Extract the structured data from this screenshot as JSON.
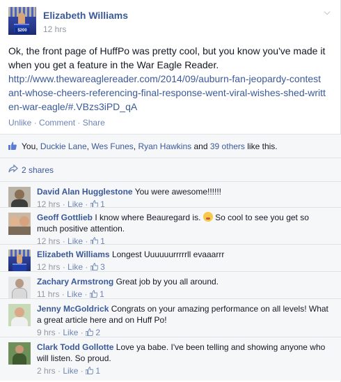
{
  "post": {
    "author": "Elizabeth Williams",
    "time": "12 hrs",
    "avatar_amount": "$200",
    "text": "Ok, the front page of HuffPo was pretty cool, but you know you've made it when you get a feature in the War Eagle Reader.",
    "url": "http://www.thewareaglereader.com/2014/09/auburn-fan-jeopardy-contestant-whose-cheers-referencing-final-response-went-viral-wishes-shed-written-war-eagle/#.VBzs3iPD_qA",
    "actions": {
      "unlike": "Unlike",
      "comment": "Comment",
      "share": "Share",
      "sep": "·"
    }
  },
  "likes": {
    "you": "You",
    "people": [
      "Duckie Lane",
      "Wes Funes",
      "Ryan Hawkins"
    ],
    "and": "and",
    "others": "39 others",
    "suffix": "like this."
  },
  "shares": {
    "label": "2 shares"
  },
  "comments": [
    {
      "name": "David Alan Hugglestone",
      "text": "You were awesome!!!!!!",
      "time": "12 hrs",
      "like": "Like",
      "count": "1"
    },
    {
      "name": "Geoff Gottlieb",
      "text": "I know where Beauregard is.",
      "text2": "So cool to see you get so much positive attention.",
      "time": "12 hrs",
      "like": "Like",
      "count": "1"
    },
    {
      "name": "Elizabeth Williams",
      "text": "Longest Uuuuuurrrrrll evaaarrr",
      "time": "12 hrs",
      "like": "Like",
      "count": "3"
    },
    {
      "name": "Zachary Armstrong",
      "text": "Great job by you all around.",
      "time": "11 hrs",
      "like": "Like",
      "count": "1"
    },
    {
      "name": "Jenny McGoldrick",
      "text": "Congrats on your amazing performance on all levels! What a great article here and on Huff Po!",
      "time": "9 hrs",
      "like": "Like",
      "count": "2"
    },
    {
      "name": "Clark Todd Gollotte",
      "text": "Love ya babe. I've been telling and showing anyone who will listen. So proud.",
      "time": "2 hrs",
      "like": "Like",
      "count": "1"
    }
  ],
  "colors": {
    "link": "#3b5998",
    "muted": "#9197a3",
    "ufi_bg": "#f6f7f9",
    "text": "#141823"
  }
}
